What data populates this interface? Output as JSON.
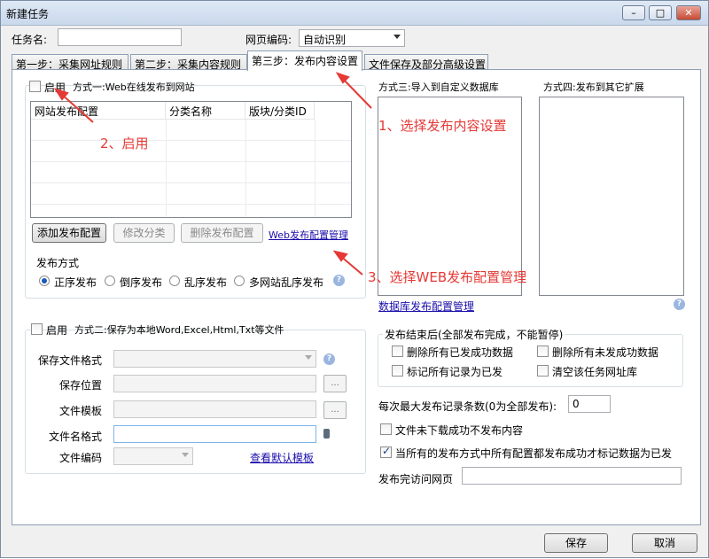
{
  "window": {
    "title": "新建任务"
  },
  "task": {
    "name_label": "任务名:",
    "name_value": "",
    "encoding_label": "网页编码:",
    "encoding_value": "自动识别"
  },
  "tabs": [
    {
      "label": "第一步：采集网址规则"
    },
    {
      "label": "第二步：采集内容规则"
    },
    {
      "label": "第三步：发布内容设置"
    },
    {
      "label": "文件保存及部分高级设置"
    }
  ],
  "method1": {
    "enable_label": "启用",
    "title": "方式一:Web在线发布到网站",
    "columns": [
      "网站发布配置",
      "分类名称",
      "版块/分类ID"
    ],
    "add_button": "添加发布配置",
    "edit_button": "修改分类",
    "delete_button": "删除发布配置",
    "manage_link": "Web发布配置管理",
    "publish_mode_label": "发布方式",
    "modes": [
      "正序发布",
      "倒序发布",
      "乱序发布",
      "多网站乱序发布"
    ]
  },
  "method2": {
    "enable_label": "启用",
    "title": "方式二:保存为本地Word,Excel,Html,Txt等文件",
    "format_label": "保存文件格式",
    "location_label": "保存位置",
    "template_label": "文件模板",
    "filename_label": "文件名格式",
    "fileenc_label": "文件编码",
    "dots": "...",
    "view_template_link": "查看默认模板"
  },
  "method3": {
    "title": "方式三:导入到自定义数据库",
    "manage_link": "数据库发布配置管理"
  },
  "method4": {
    "title": "方式四:发布到其它扩展"
  },
  "after_publish": {
    "title": "发布结束后(全部发布完成，不能暂停)",
    "options": [
      "删除所有已发成功数据",
      "删除所有未发成功数据",
      "标记所有记录为已发",
      "清空该任务网址库"
    ]
  },
  "max_records": {
    "label": "每次最大发布记录条数(0为全部发布):",
    "value": "0"
  },
  "no_publish_label": "文件未下载成功不发布内容",
  "mark_all_label": "当所有的发布方式中所有配置都发布成功才标记数据为已发",
  "visit_label": "发布完访问网页",
  "annotations": [
    "1、选择发布内容设置",
    "2、启用",
    "3、选择WEB发布配置管理"
  ],
  "footer": {
    "save": "保存",
    "cancel": "取消"
  },
  "colors": {
    "annotation": "#e53935",
    "link": "#1a0dab"
  }
}
